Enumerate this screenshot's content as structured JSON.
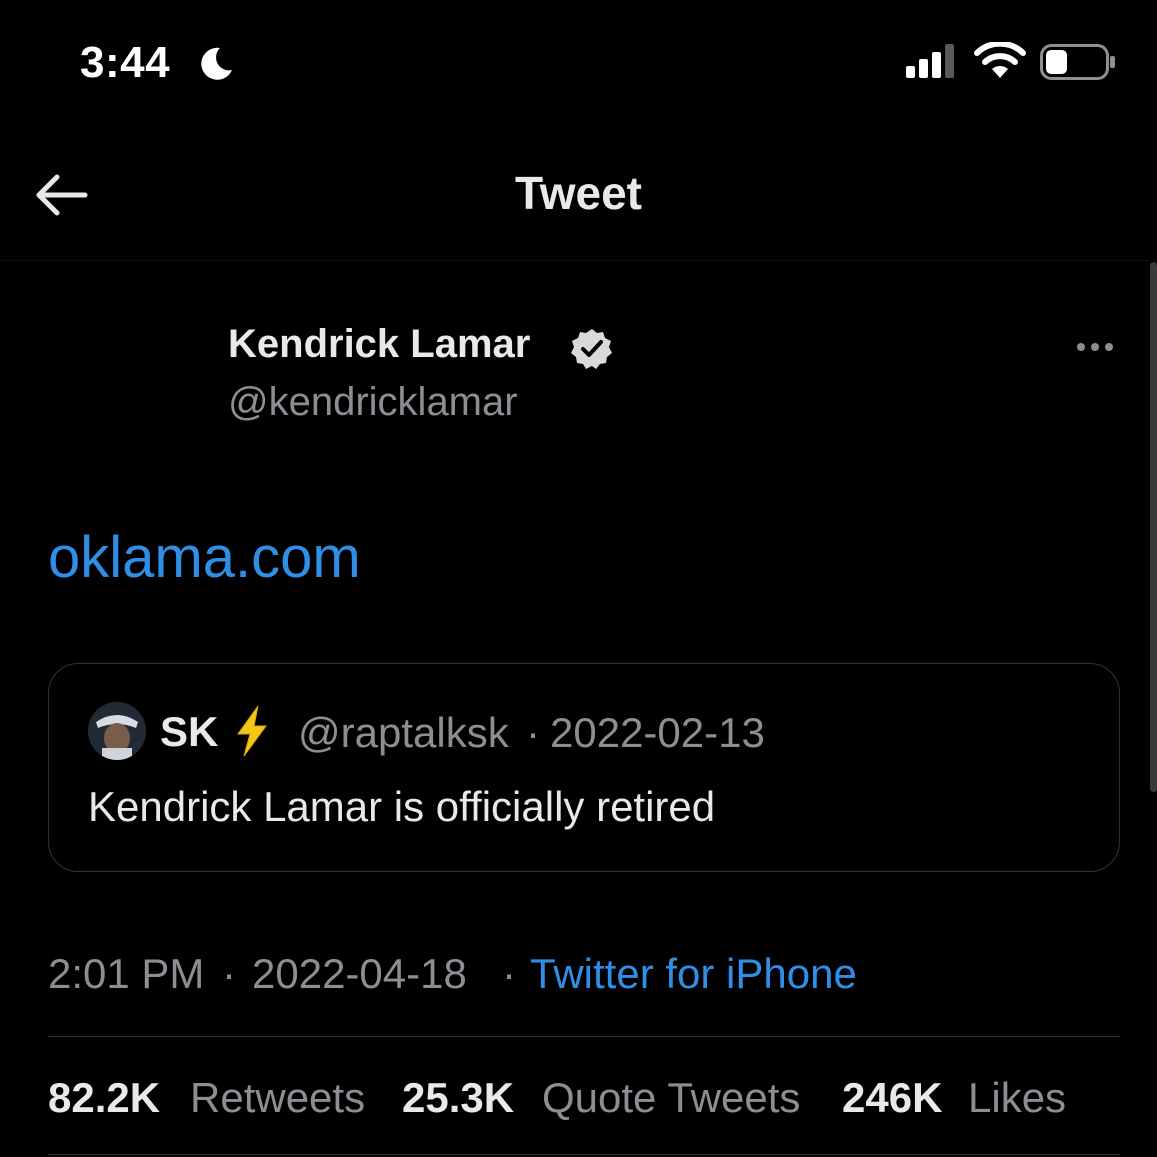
{
  "status_bar": {
    "time": "3:44",
    "icons": [
      "moon-icon",
      "signal-icon",
      "wifi-icon",
      "battery-icon"
    ]
  },
  "header": {
    "title": "Tweet",
    "back_icon": "arrow-left-icon"
  },
  "tweet": {
    "author_name": "Kendrick Lamar",
    "author_handle": "@kendricklamar",
    "verified": true,
    "text_link": "oklama.com",
    "more_icon": "ellipsis-icon",
    "quote": {
      "name": "SK",
      "name_emoji": "⚡",
      "handle": "@raptalksk",
      "separator": "·",
      "date": "2022-02-13",
      "text": "Kendrick Lamar is officially retired"
    },
    "meta": {
      "time": "2:01 PM",
      "separator": "·",
      "date": "2022-04-18",
      "source": "Twitter for iPhone"
    },
    "stats": {
      "retweets_count": "82.2K",
      "retweets_label": "Retweets",
      "quotes_count": "25.3K",
      "quotes_label": "Quote Tweets",
      "likes_count": "246K",
      "likes_label": "Likes"
    }
  },
  "colors": {
    "background": "#000000",
    "primary_text": "#e7e9ea",
    "secondary_text": "#8b8f94",
    "link": "#2f8fe6",
    "border": "#2f3336"
  }
}
